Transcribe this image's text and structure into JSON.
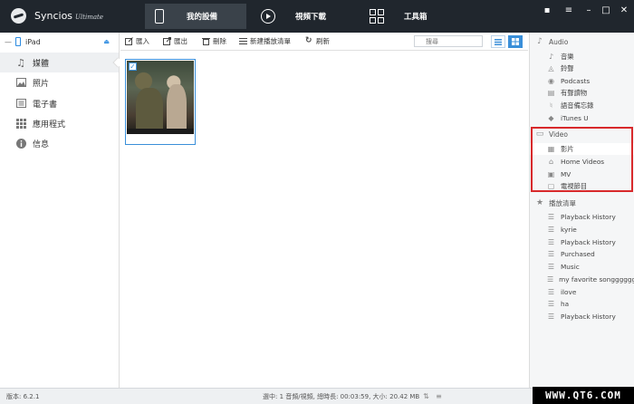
{
  "titlebar": {
    "app_name": "Syncios",
    "app_edition": "Ultimate",
    "tabs": [
      {
        "label": "我的設備",
        "icon": "phone-icon",
        "active": true
      },
      {
        "label": "視頻下載",
        "icon": "play-icon",
        "active": false
      },
      {
        "label": "工具箱",
        "icon": "toolbox-icon",
        "active": false
      }
    ],
    "window_controls": [
      "feedback-icon",
      "menu-icon",
      "minimize-icon",
      "maximize-icon",
      "close-icon"
    ]
  },
  "sidebar": {
    "device": {
      "name": "iPad",
      "icon": "ipad-icon"
    },
    "items": [
      {
        "label": "媒體",
        "icon": "music-icon",
        "active": true
      },
      {
        "label": "照片",
        "icon": "photo-icon",
        "active": false
      },
      {
        "label": "電子書",
        "icon": "book-icon",
        "active": false
      },
      {
        "label": "應用程式",
        "icon": "apps-icon",
        "active": false
      },
      {
        "label": "信息",
        "icon": "info-icon",
        "active": false
      }
    ]
  },
  "toolbar": {
    "import_label": "匯入",
    "export_label": "匯出",
    "delete_label": "刪除",
    "new_playlist_label": "新建播放清單",
    "refresh_label": "刷新",
    "search_placeholder": "搜尋"
  },
  "content": {
    "items": [
      {
        "type": "video-thumbnail",
        "checked": true
      }
    ]
  },
  "library": {
    "audio": {
      "title": "Audio",
      "items": [
        "音樂",
        "鈴聲",
        "Podcasts",
        "有聲讀物",
        "語音備忘錄",
        "iTunes U"
      ]
    },
    "video": {
      "title": "Video",
      "items": [
        "影片",
        "Home Videos",
        "MV",
        "電視節目"
      ]
    },
    "playlists": {
      "title": "播放清單",
      "items": [
        "Playback History",
        "kyrie",
        "Playback History",
        "Purchased",
        "Music",
        "my favorite songggggggggg",
        "ilove",
        "ha",
        "Playback History"
      ]
    }
  },
  "statusbar": {
    "version": "版本: 6.2.1",
    "info": "選中: 1 音頻/視頻, 總時長: 00:03:59, 大小: 20.42 MB"
  },
  "watermark": "WWW.QT6.COM",
  "colors": {
    "titlebar": "#20262d",
    "accent": "#3a8fd9",
    "highlight_box": "#d8292b"
  }
}
